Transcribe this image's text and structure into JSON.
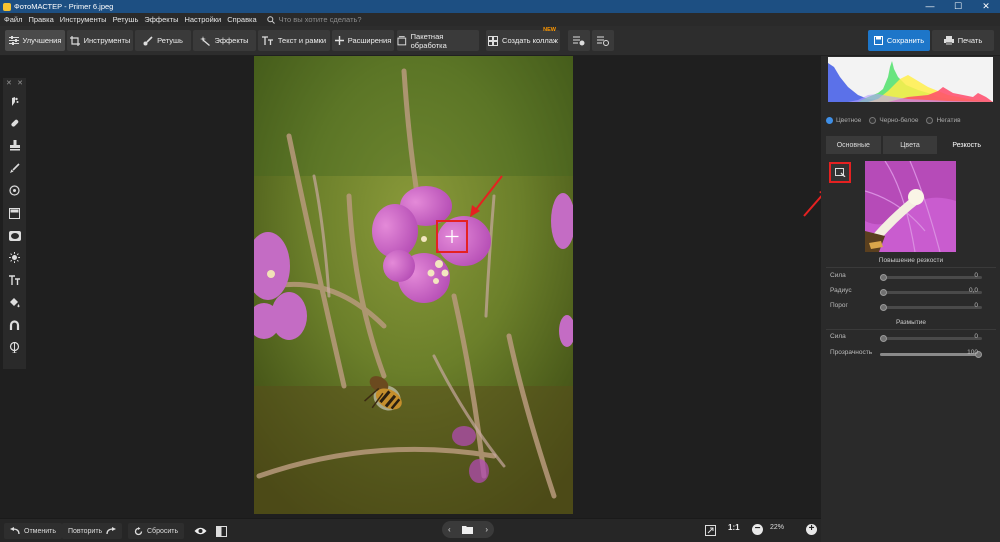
{
  "app": {
    "title": "ФотоМАСТЕР - Primer 6.jpeg"
  },
  "window_controls": {
    "minimize": "—",
    "maximize": "☐",
    "close": "✕"
  },
  "menu": {
    "items": [
      "Файл",
      "Правка",
      "Инструменты",
      "Ретушь",
      "Эффекты",
      "Настройки",
      "Справка"
    ],
    "search_placeholder": "Что вы хотите сделать?"
  },
  "toolbar": {
    "improvements": "Улучшения",
    "instruments": "Инструменты",
    "retouch": "Ретушь",
    "effects": "Эффекты",
    "text_frames": "Текст и рамки",
    "extensions": "Расширения",
    "batch": "Пакетная обработка",
    "collage": "Создать коллаж",
    "collage_badge": "NEW",
    "save": "Сохранить",
    "print": "Печать"
  },
  "left_panel": {
    "close_left": "✕",
    "close_right": "✕"
  },
  "bottom": {
    "undo": "Отменить",
    "redo": "Повторить",
    "reset": "Сбросить",
    "ratio": "1:1",
    "zoom": "22%",
    "prev": "‹",
    "next": "›"
  },
  "right_panel": {
    "modes": [
      {
        "label": "Цветное",
        "selected": true
      },
      {
        "label": "Черно-белое",
        "selected": false
      },
      {
        "label": "Негатив",
        "selected": false
      }
    ],
    "tabs": [
      {
        "label": "Основные",
        "active": false
      },
      {
        "label": "Цвета",
        "active": false
      },
      {
        "label": "Резкость",
        "active": true
      }
    ],
    "sharpen_section": "Повышение резкости",
    "sharpen": {
      "strength": {
        "label": "Сила",
        "value": "0",
        "level": 0
      },
      "radius": {
        "label": "Радиус",
        "value": "0,0",
        "level": 0
      },
      "threshold": {
        "label": "Порог",
        "value": "0",
        "level": 0
      }
    },
    "blur_section": "Размытие",
    "blur": {
      "strength": {
        "label": "Сила",
        "value": "0",
        "level": 0
      },
      "transparency": {
        "label": "Прозрачность",
        "value": "100",
        "level": 100
      }
    }
  },
  "colors": {
    "accent": "#1d76c9",
    "highlight": "#e52121",
    "titlebar": "#1d4f82"
  }
}
